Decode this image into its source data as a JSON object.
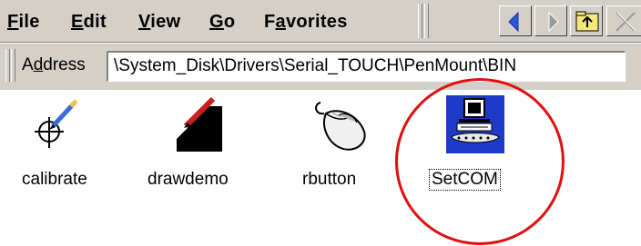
{
  "menu": {
    "file": "File",
    "edit": "Edit",
    "view": "View",
    "go": "Go",
    "favorites": "Favorites"
  },
  "toolbar": {
    "back_icon": "back-arrow-icon",
    "forward_icon": "forward-arrow-icon",
    "up_icon": "up-folder-icon",
    "close_icon": "close-icon"
  },
  "address": {
    "label": "Address",
    "value": "\\System_Disk\\Drivers\\Serial_TOUCH\\PenMount\\BIN"
  },
  "files": [
    {
      "name": "calibrate",
      "icon": "crosshair-pen-icon"
    },
    {
      "name": "drawdemo",
      "icon": "drawing-pen-icon"
    },
    {
      "name": "rbutton",
      "icon": "mouse-icon"
    },
    {
      "name": "SetCOM",
      "icon": "computer-setup-icon",
      "selected": true
    }
  ],
  "colors": {
    "chrome": "#d4d0c8",
    "highlight_circle": "#e01010",
    "nav_arrow": "#2a55d8"
  }
}
